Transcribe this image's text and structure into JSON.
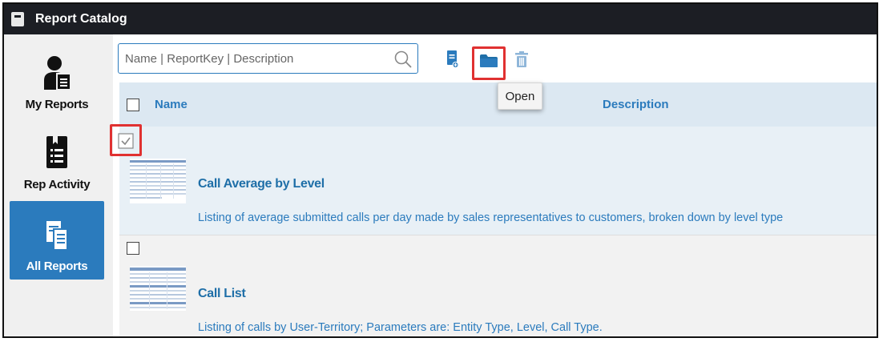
{
  "window": {
    "title": "Report Catalog"
  },
  "sidebar": {
    "items": [
      {
        "label": "My Reports",
        "icon": "user-report-icon",
        "active": false
      },
      {
        "label": "Rep Activity",
        "icon": "activity-list-icon",
        "active": false
      },
      {
        "label": "All Reports",
        "icon": "reports-stack-icon",
        "active": true
      }
    ]
  },
  "toolbar": {
    "search_placeholder": "Name | ReportKey | Description",
    "search_value": "",
    "actions": [
      {
        "name": "new-report",
        "icon": "new-document-icon"
      },
      {
        "name": "open",
        "icon": "folder-icon",
        "tooltip": "Open"
      },
      {
        "name": "delete",
        "icon": "trash-icon"
      }
    ]
  },
  "table": {
    "columns": [
      "Name",
      "Description"
    ],
    "rows": [
      {
        "name": "Call Average by Level",
        "description": "Listing of average submitted calls per day made by sales representatives to customers, broken down by level type",
        "checked": true
      },
      {
        "name": "Call List",
        "description": "Listing of calls by User-Territory; Parameters are: Entity Type, Level, Call Type.",
        "checked": false
      }
    ]
  },
  "colors": {
    "titlebar": "#1c1e24",
    "accent": "#2b7bbd",
    "highlight": "#e03131",
    "header_bg": "#dce8f2"
  }
}
